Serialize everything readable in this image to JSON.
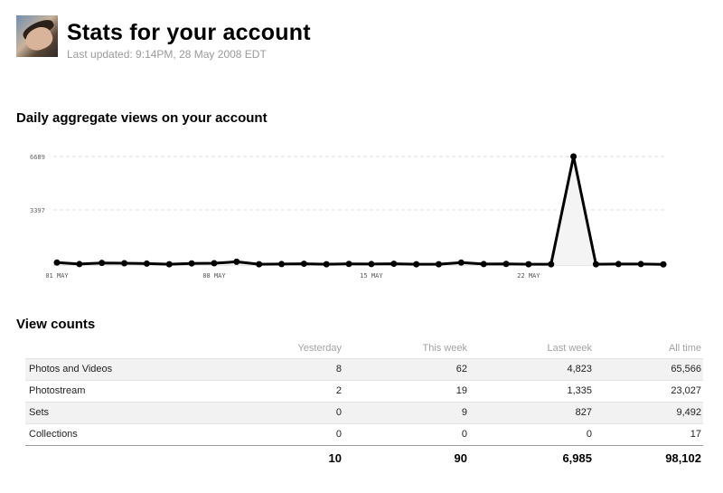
{
  "header": {
    "title": "Stats for your account",
    "last_updated": "Last updated: 9:14PM, 28 May 2008 EDT"
  },
  "chart_section": {
    "title": "Daily aggregate views on your account"
  },
  "chart_data": {
    "type": "area",
    "title": "Daily aggregate views on your account",
    "xlabel": "",
    "ylabel": "",
    "y_ticks": [
      "6689",
      "3397"
    ],
    "x_tick_labels": [
      "01 MAY",
      "08 MAY",
      "15 MAY",
      "22 MAY"
    ],
    "x_tick_indices": [
      0,
      7,
      14,
      21
    ],
    "ylim": [
      0,
      6689
    ],
    "grid": true,
    "legend": "none",
    "x": [
      "01 May",
      "02 May",
      "03 May",
      "04 May",
      "05 May",
      "06 May",
      "07 May",
      "08 May",
      "09 May",
      "10 May",
      "11 May",
      "12 May",
      "13 May",
      "14 May",
      "15 May",
      "16 May",
      "17 May",
      "18 May",
      "19 May",
      "20 May",
      "21 May",
      "22 May",
      "23 May",
      "24 May",
      "25 May",
      "26 May",
      "27 May",
      "28 May"
    ],
    "values": [
      150,
      60,
      130,
      110,
      90,
      50,
      100,
      110,
      200,
      50,
      60,
      80,
      50,
      70,
      60,
      80,
      50,
      50,
      150,
      60,
      70,
      50,
      50,
      6689,
      50,
      60,
      60,
      40
    ],
    "colors": {
      "line": "#000000",
      "fill": "#f4f4f4",
      "grid": "#dddddd"
    }
  },
  "view_counts": {
    "title": "View counts",
    "columns": [
      "Yesterday",
      "This week",
      "Last week",
      "All time"
    ],
    "rows": [
      {
        "label": "Photos and Videos",
        "values": [
          "8",
          "62",
          "4,823",
          "65,566"
        ]
      },
      {
        "label": "Photostream",
        "values": [
          "2",
          "19",
          "1,335",
          "23,027"
        ]
      },
      {
        "label": "Sets",
        "values": [
          "0",
          "9",
          "827",
          "9,492"
        ]
      },
      {
        "label": "Collections",
        "values": [
          "0",
          "0",
          "0",
          "17"
        ]
      }
    ],
    "totals": [
      "10",
      "90",
      "6,985",
      "98,102"
    ]
  }
}
